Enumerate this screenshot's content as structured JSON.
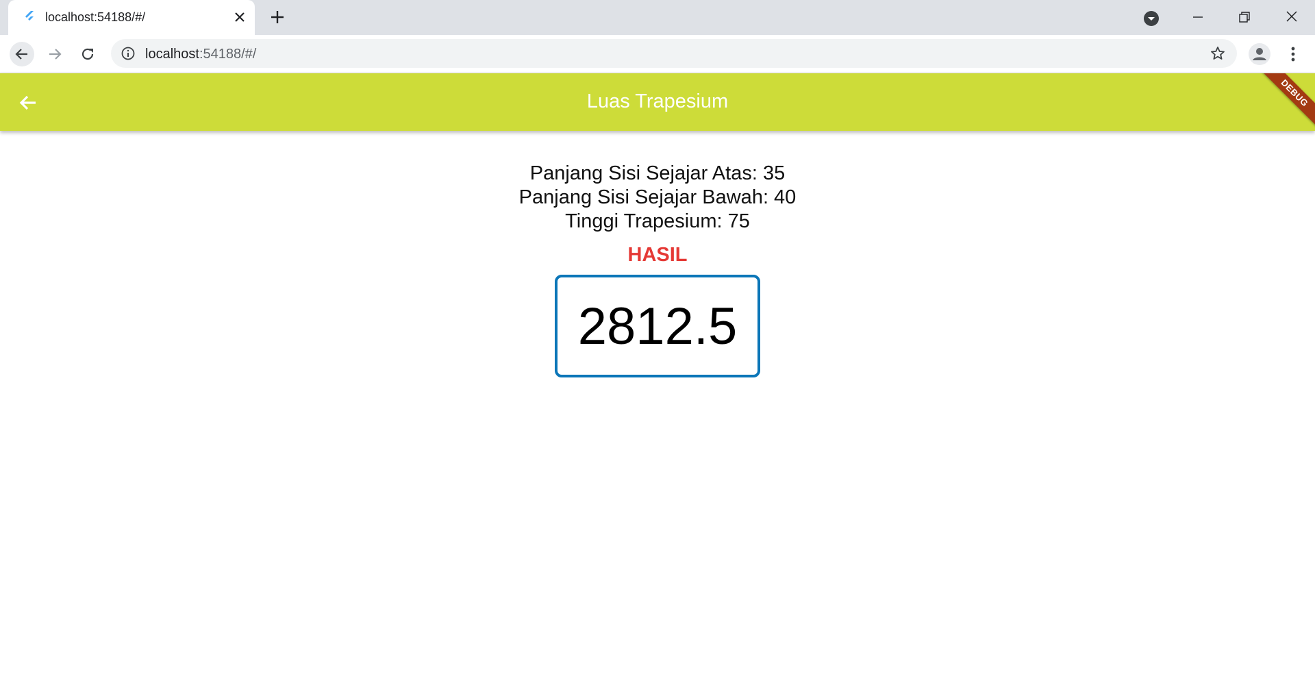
{
  "browser": {
    "tab_title": "localhost:54188/#/",
    "url_host": "localhost",
    "url_rest": ":54188/#/"
  },
  "app": {
    "appbar_title": "Luas Trapesium",
    "appbar_color": "#cddc39",
    "debug_banner": "DEBUG",
    "lines": [
      "Panjang Sisi Sejajar Atas: 35",
      "Panjang Sisi Sejajar Bawah: 40",
      "Tinggi Trapesium: 75"
    ],
    "result_label": "HASIL",
    "result_value": "2812.5"
  }
}
